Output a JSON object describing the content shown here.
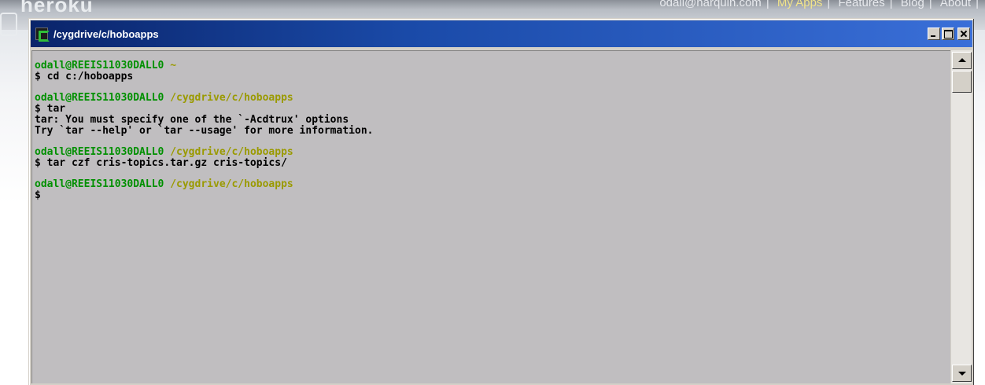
{
  "background_page": {
    "logo_text": "heroku",
    "nav": {
      "email": "odall@harquin.com",
      "my_apps": "My Apps",
      "features": "Features",
      "blog": "Blog",
      "about": "About",
      "separator": "|"
    }
  },
  "window": {
    "title": "/cygdrive/c/hoboapps",
    "icon": "cygwin-terminal-icon",
    "buttons": {
      "minimize": "minimize-icon",
      "maximize": "maximize-icon",
      "close": "close-icon"
    }
  },
  "terminal": {
    "blocks": [
      {
        "prompt_user": "odall@REEIS11030DALL0",
        "prompt_path": "~",
        "command": "$ cd c:/hoboapps",
        "output": []
      },
      {
        "prompt_user": "odall@REEIS11030DALL0",
        "prompt_path": "/cygdrive/c/hoboapps",
        "command": "$ tar",
        "output": [
          "tar: You must specify one of the `-Acdtrux' options",
          "Try `tar --help' or `tar --usage' for more information."
        ]
      },
      {
        "prompt_user": "odall@REEIS11030DALL0",
        "prompt_path": "/cygdrive/c/hoboapps",
        "command": "$ tar czf cris-topics.tar.gz cris-topics/",
        "output": []
      },
      {
        "prompt_user": "odall@REEIS11030DALL0",
        "prompt_path": "/cygdrive/c/hoboapps",
        "command": "$",
        "output": []
      }
    ]
  },
  "colors": {
    "prompt_user": "#009000",
    "prompt_path": "#9a9a00",
    "terminal_bg": "#c0bec0",
    "titlebar_start": "#0a246a",
    "titlebar_end": "#3a6fd8"
  }
}
